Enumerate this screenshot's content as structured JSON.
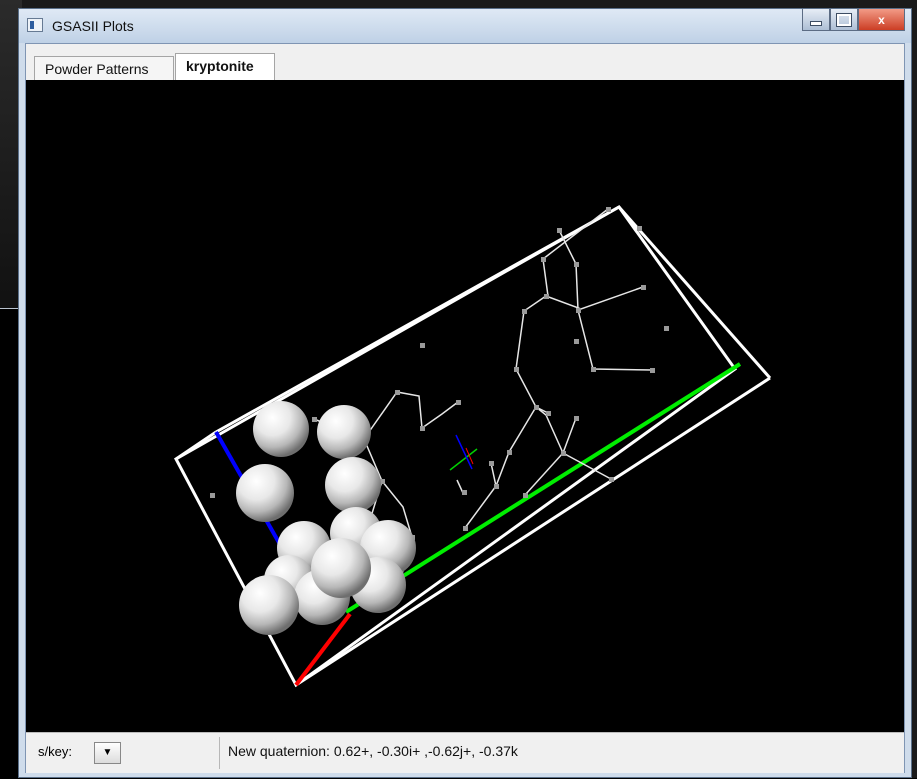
{
  "window": {
    "title": "GSASII Plots",
    "close_label": "x"
  },
  "tabs": [
    {
      "label": "Powder Patterns"
    },
    {
      "label": "kryptonite"
    }
  ],
  "status": {
    "key_label": "s/key:",
    "dropdown_arrow": "▼",
    "message": "New quaternion: 0.62+, -0.30i+ ,-0.62j+, -0.37k"
  },
  "colors": {
    "plot_background": "#000000",
    "cell_edges": "#ffffff",
    "a_axis": "#ff0000",
    "b_axis": "#00ff00",
    "c_axis": "#0000ff"
  },
  "icons": {
    "window_icon": "window-icon",
    "minimize": "minimize-icon",
    "maximize": "maximize-icon",
    "close": "close-icon",
    "dropdown": "chevron-down-icon"
  }
}
